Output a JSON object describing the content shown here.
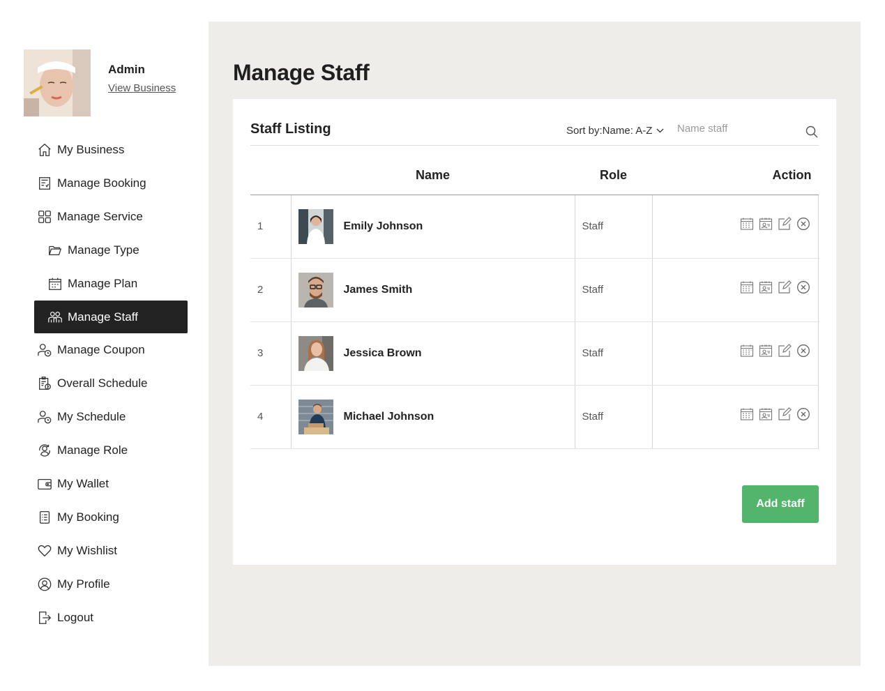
{
  "sidebar": {
    "user_name": "Admin",
    "view_business": "View Business",
    "items": [
      {
        "label": "My Business",
        "icon": "home-icon"
      },
      {
        "label": "Manage Booking",
        "icon": "receipt-icon"
      },
      {
        "label": "Manage Service",
        "icon": "grid-icon"
      },
      {
        "label": "Manage Type",
        "icon": "folder-icon"
      },
      {
        "label": "Manage Plan",
        "icon": "calendar-icon"
      },
      {
        "label": "Manage Staff",
        "icon": "people-icon"
      },
      {
        "label": "Manage Coupon",
        "icon": "user-clock-icon"
      },
      {
        "label": "Overall Schedule",
        "icon": "clipboard-icon"
      },
      {
        "label": "My Schedule",
        "icon": "user-clock-icon"
      },
      {
        "label": "Manage Role",
        "icon": "role-icon"
      },
      {
        "label": "My Wallet",
        "icon": "wallet-icon"
      },
      {
        "label": "My Booking",
        "icon": "list-icon"
      },
      {
        "label": "My Wishlist",
        "icon": "heart-icon"
      },
      {
        "label": "My Profile",
        "icon": "profile-icon"
      },
      {
        "label": "Logout",
        "icon": "logout-icon"
      }
    ],
    "active_item": "Manage Staff"
  },
  "main": {
    "title": "Manage Staff",
    "card_title": "Staff Listing",
    "sort_label": "Sort by:Name: A-Z",
    "search_placeholder": "Name staff",
    "columns": {
      "name": "Name",
      "role": "Role",
      "action": "Action"
    },
    "rows": [
      {
        "num": "1",
        "name": "Emily Johnson",
        "role": "Staff"
      },
      {
        "num": "2",
        "name": "James Smith",
        "role": "Staff"
      },
      {
        "num": "3",
        "name": "Jessica Brown",
        "role": "Staff"
      },
      {
        "num": "4",
        "name": "Michael Johnson",
        "role": "Staff"
      }
    ],
    "add_button": "Add staff"
  },
  "colors": {
    "accent_green": "#52b56b",
    "active_nav_bg": "#232323",
    "main_bg": "#eeedea"
  }
}
